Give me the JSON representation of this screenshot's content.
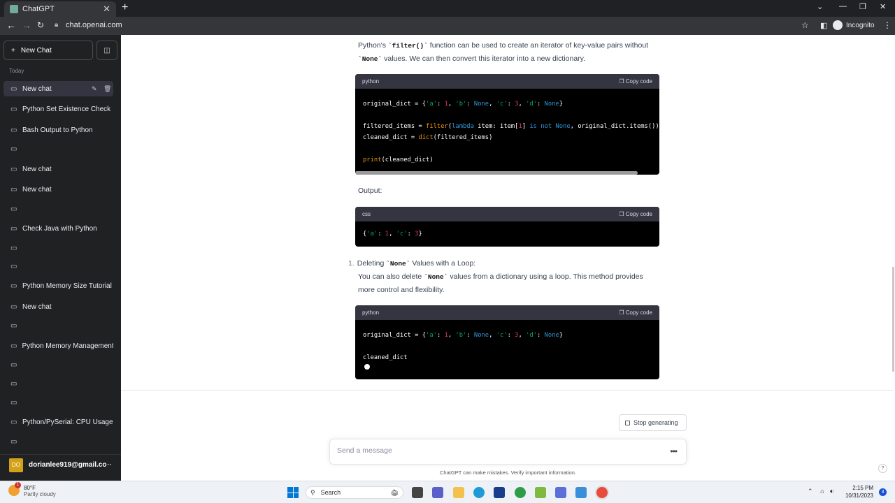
{
  "browser": {
    "tab_title": "ChatGPT",
    "url": "chat.openai.com",
    "profile": "Incognito"
  },
  "sidebar": {
    "new_chat_label": "New Chat",
    "section_today": "Today",
    "items": [
      {
        "label": "New chat"
      },
      {
        "label": "Python Set Existence Check"
      },
      {
        "label": "Bash Output to Python"
      },
      {
        "label": ""
      },
      {
        "label": "New chat"
      },
      {
        "label": "New chat"
      },
      {
        "label": ""
      },
      {
        "label": "Check Java with Python"
      },
      {
        "label": ""
      },
      {
        "label": ""
      },
      {
        "label": "Python Memory Size Tutorial"
      },
      {
        "label": "New chat"
      },
      {
        "label": ""
      },
      {
        "label": "Python Memory Management"
      },
      {
        "label": ""
      },
      {
        "label": ""
      },
      {
        "label": ""
      },
      {
        "label": "Python/PySerial: CPU Usage"
      },
      {
        "label": ""
      }
    ],
    "user_initials": "DO",
    "user_email": "dorianlee919@gmail.co"
  },
  "conversation": {
    "para1_a": "Python's ",
    "para1_code": "`filter()`",
    "para1_b": " function can be used to create an iterator of key-value pairs without",
    "para1_code2": "`None`",
    "para1_c": " values. We can then convert this iterator into a new dictionary.",
    "code1_lang": "python",
    "copy_label": "Copy code",
    "output_label": "Output:",
    "code2_lang": "css",
    "list_number": "1.",
    "list_a": "Deleting ",
    "list_code": "`None`",
    "list_b": " Values with a Loop:",
    "para2_a": "You can also delete ",
    "para2_code": "`None`",
    "para2_b": " values from a dictionary using a loop. This method provides",
    "para2_c": "more control and flexibility.",
    "code3_lang": "python"
  },
  "composer": {
    "stop_label": "Stop generating",
    "placeholder": "Send a message",
    "disclaimer": "ChatGPT can make mistakes. Verify important information.",
    "help": "?"
  },
  "taskbar": {
    "temp": "80°F",
    "weather": "Partly cloudy",
    "weather_badge": "1",
    "search_label": "Search",
    "time": "2:15 PM",
    "date": "10/31/2023",
    "notif_count": "3"
  },
  "colors": {
    "sidebar_bg": "#202123",
    "code_bg": "#000000",
    "code_header": "#343541"
  }
}
